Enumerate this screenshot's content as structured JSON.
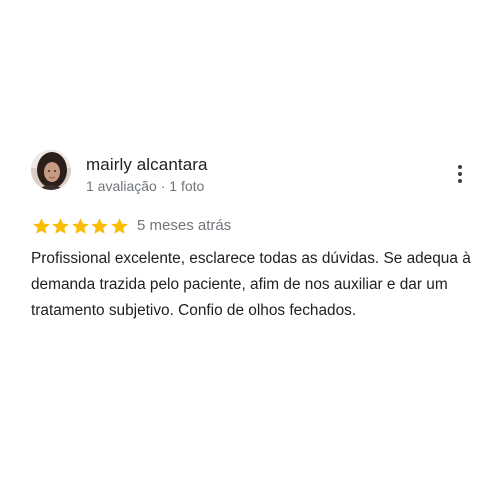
{
  "review": {
    "author": {
      "name": "mairly alcantara",
      "meta": "1 avaliação · 1 foto"
    },
    "rating": {
      "stars": 5,
      "max": 5,
      "star_color": "#fbbc04"
    },
    "date": "5 meses atrás",
    "text": "Profissional excelente, esclarece todas as dúvidas. Se adequa à demanda trazida pelo paciente, afim de nos auxiliar e dar um tratamento subjetivo. Confio de olhos fechados.",
    "more_icon": "more-vert-icon"
  }
}
